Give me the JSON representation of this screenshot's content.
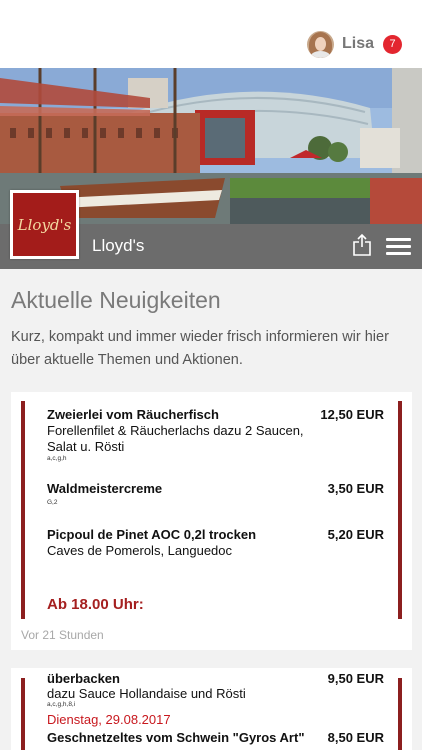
{
  "user": {
    "name": "Lisa",
    "notifications": "7"
  },
  "venue": {
    "name": "Lloyd's",
    "logo_text": "Lloyd's"
  },
  "page": {
    "heading": "Aktuelle Neuigkeiten",
    "intro": "Kurz, kompakt und immer wieder frisch informieren wir hier über aktuelle Themen und Aktionen."
  },
  "posts": [
    {
      "time": "Vor 21 Stunden",
      "menu": {
        "item1": {
          "title": "Zweierlei vom Räucherfisch",
          "desc1": "Forellenfilet & Räucherlachs dazu 2 Saucen,",
          "desc2": "Salat u. Rösti",
          "allergens": "a,c,g,h",
          "price": "12,50 EUR"
        },
        "item2": {
          "title": "Waldmeistercreme",
          "allergens": "G,2",
          "price": "3,50 EUR"
        },
        "item3": {
          "title": "Picpoul de Pinet AOC 0,2l trocken",
          "desc1": "Caves de Pomerols, Languedoc",
          "price": "5,20 EUR"
        },
        "footer": "Ab 18.00 Uhr:"
      }
    },
    {
      "menu": {
        "cut_title": "überbacken",
        "cut_price": "9,50 EUR",
        "desc1": "dazu Sauce Hollandaise und Rösti",
        "allergens": "a,c,g,h,8,i",
        "date": "Dienstag, 29.08.2017",
        "item_title": "Geschnetzeltes vom Schwein \"Gyros Art\"",
        "item_price": "8,50 EUR"
      }
    }
  ],
  "colors": {
    "accent_red": "#e3262f",
    "bar_gray": "#6c6c6c",
    "menu_border": "#8c1f1f"
  },
  "icons": {
    "share": "share-icon",
    "menu": "hamburger-menu-icon"
  }
}
